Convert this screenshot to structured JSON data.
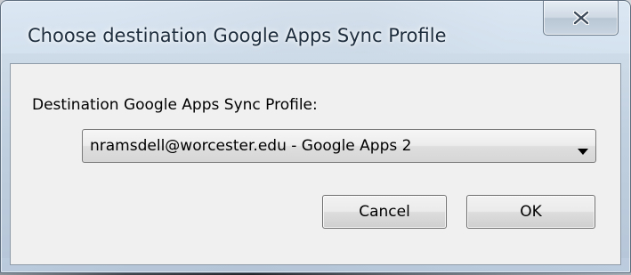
{
  "dialog": {
    "title": "Choose destination Google Apps Sync Profile",
    "close_icon": "close-icon",
    "label": "Destination Google Apps Sync Profile:",
    "profile_select": {
      "selected_value": "nramsdell@worcester.edu - Google Apps 2",
      "arrow_icon": "chevron-down-icon"
    },
    "cancel_label": "Cancel",
    "ok_label": "OK"
  },
  "colors": {
    "title_text": "#1e2d3d",
    "client_background": "#f0f0f0",
    "frame_glass": "#c8d8e8"
  }
}
